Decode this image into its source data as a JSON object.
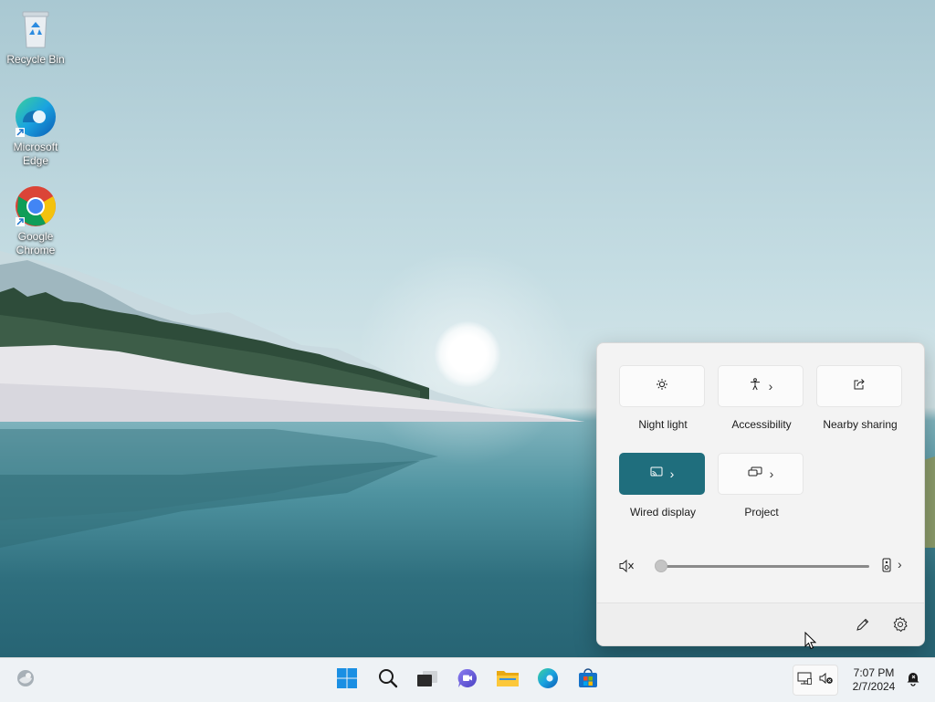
{
  "desktop": {
    "icons": [
      {
        "label": "Recycle Bin",
        "icon": "recycle-bin-icon"
      },
      {
        "label": "Microsoft Edge",
        "icon": "edge-icon"
      },
      {
        "label": "Google Chrome",
        "icon": "chrome-icon"
      }
    ]
  },
  "quick_settings": {
    "tiles": [
      {
        "label": "Night light",
        "icon": "night-light-icon",
        "has_chevron": false,
        "active": false
      },
      {
        "label": "Accessibility",
        "icon": "accessibility-icon",
        "has_chevron": true,
        "active": false
      },
      {
        "label": "Nearby sharing",
        "icon": "share-icon",
        "has_chevron": false,
        "active": false
      },
      {
        "label": "Wired display",
        "icon": "cast-icon",
        "has_chevron": true,
        "active": true
      },
      {
        "label": "Project",
        "icon": "project-icon",
        "has_chevron": true,
        "active": false
      }
    ],
    "volume": {
      "level": 0,
      "muted": true
    },
    "accent_color": "#1f6e7d",
    "footer": {
      "edit_icon": "pencil-icon",
      "settings_icon": "gear-icon"
    }
  },
  "taskbar": {
    "left": "widgets-icon",
    "center": [
      "start-icon",
      "search-icon",
      "task-view-icon",
      "chat-icon",
      "file-explorer-icon",
      "edge-icon",
      "store-icon"
    ],
    "tray": [
      "network-icon",
      "volume-muted-icon"
    ],
    "clock": {
      "time": "7:07 PM",
      "date": "2/7/2024"
    },
    "notification_icon": "notification-bell-icon"
  }
}
